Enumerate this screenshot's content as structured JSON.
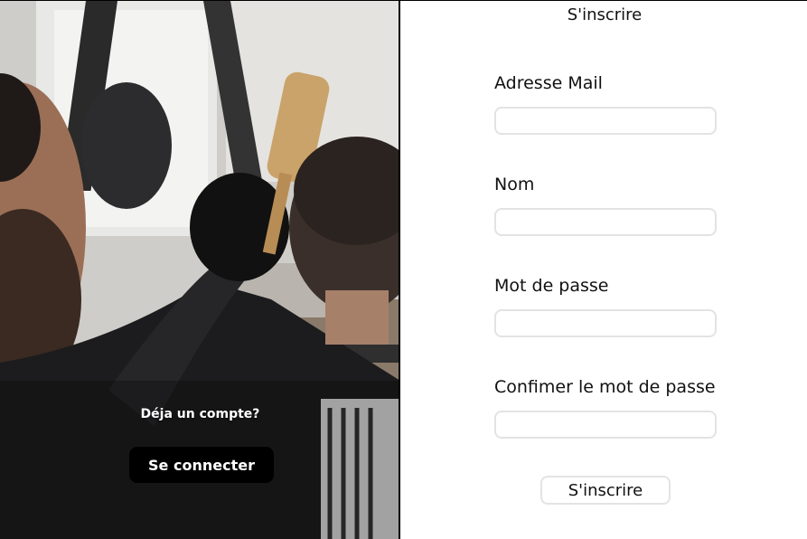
{
  "left_panel": {
    "image": "barbershop-haircut-photo",
    "prompt_text": "Déja un compte?",
    "login_button_label": "Se connecter"
  },
  "form": {
    "title": "S'inscrire",
    "fields": [
      {
        "label": "Adresse Mail",
        "value": "",
        "placeholder": ""
      },
      {
        "label": "Nom",
        "value": "",
        "placeholder": ""
      },
      {
        "label": "Mot de passe",
        "value": "",
        "placeholder": ""
      },
      {
        "label": "Confimer le mot de passe",
        "value": "",
        "placeholder": ""
      }
    ],
    "submit_label": "S'inscrire"
  },
  "colors": {
    "button_dark": "#000000",
    "input_border": "#e3e3e3"
  }
}
